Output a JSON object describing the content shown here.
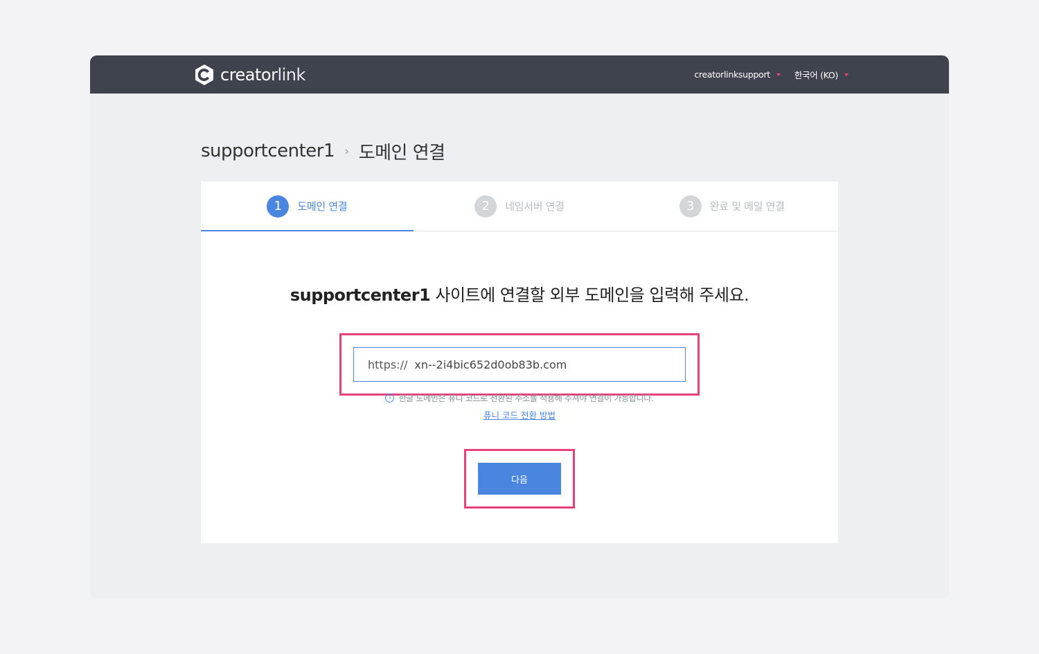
{
  "header": {
    "logo_bold": "creator",
    "logo_light": "link",
    "account": "creatorlinksupport",
    "language": "한국어 (KO)"
  },
  "breadcrumb": {
    "site": "supportcenter1",
    "page": "도메인 연결"
  },
  "steps": [
    {
      "num": "1",
      "label": "도메인 연결",
      "active": true
    },
    {
      "num": "2",
      "label": "네임서버 연결",
      "active": false
    },
    {
      "num": "3",
      "label": "완료 및 메일 연결",
      "active": false
    }
  ],
  "main": {
    "prompt_site": "supportcenter1",
    "prompt_text": " 사이트에 연결할 외부 도메인을 입력해 주세요.",
    "input_prefix": "https://",
    "input_value": "xn--2i4bic652d0ob83b.com",
    "notice": "한글 도메인은 퓨니 코드로 전환된 주소를 적용해 주셔야 연결이 가능합니다.",
    "guide_link": "퓨니 코드 전환 방법",
    "next_label": "다음"
  },
  "colors": {
    "accent": "#4a86e0",
    "highlight": "#e8417a",
    "topbar": "#3e434d"
  }
}
